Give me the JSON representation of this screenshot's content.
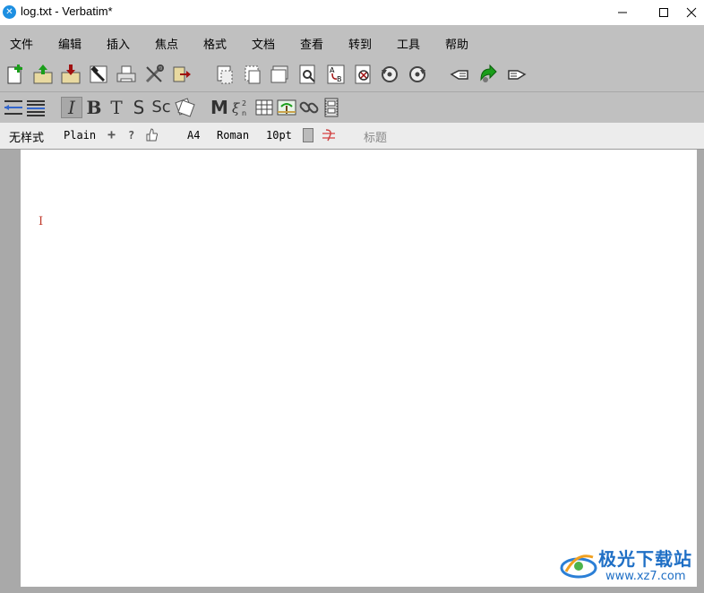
{
  "window": {
    "title": "log.txt - Verbatim*",
    "icon": "verbatim-app-icon"
  },
  "menu": [
    "文件",
    "编辑",
    "插入",
    "焦点",
    "格式",
    "文档",
    "查看",
    "转到",
    "工具",
    "帮助"
  ],
  "toolbar1": {
    "icons": [
      "new-file-icon",
      "open-file-icon",
      "save-file-icon",
      "build-hammer-icon",
      "print-icon",
      "tools-icon",
      "exit-icon",
      "cut-icon",
      "copy-icon",
      "paste-icon",
      "find-icon",
      "replace-icon",
      "clear-find-icon",
      "undo-icon",
      "redo-icon",
      "back-hand-icon",
      "jump-icon",
      "forward-hand-icon"
    ]
  },
  "toolbar2": {
    "letters": {
      "italic": "I",
      "bold": "B",
      "typewriter": "T",
      "strike": "S",
      "smallcaps": "Sc",
      "math": "M"
    }
  },
  "stylebar": {
    "style": "无样式",
    "variant": "Plain",
    "plus": "+",
    "question": "?",
    "paper": "A4",
    "font": "Roman",
    "size": "10pt",
    "heading": "标题"
  },
  "editor": {
    "cursor": "I"
  },
  "watermark": {
    "name": "极光下载站",
    "url": "www.xz7.com"
  },
  "colors": {
    "chrome": "#c0c0c0",
    "accent": "#1d8fe1",
    "cursor": "#c0392b"
  }
}
